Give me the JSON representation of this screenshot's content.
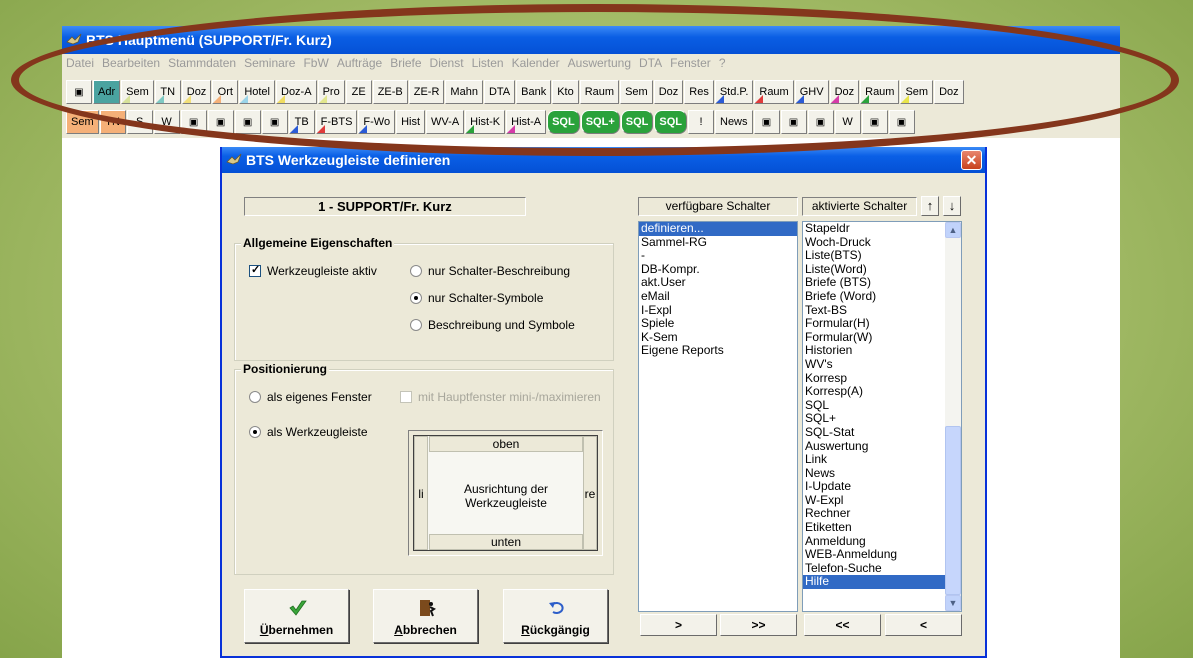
{
  "app": {
    "title": "BTS Hauptmenü (SUPPORT/Fr. Kurz)",
    "menu": [
      "Datei",
      "Bearbeiten",
      "Stammdaten",
      "Seminare",
      "FbW",
      "Aufträge",
      "Briefe",
      "Dienst",
      "Listen",
      "Kalender",
      "Auswertung",
      "DTA",
      "Fenster",
      "?"
    ]
  },
  "toolbar1": [
    {
      "label": "",
      "icon": "door-exit-icon"
    },
    {
      "label": "Adr",
      "color": "#4aa3a0",
      "style": "filled"
    },
    {
      "label": "Sem",
      "color": "#d7e29a"
    },
    {
      "label": "TN",
      "color": "#7ec9c3"
    },
    {
      "label": "Doz",
      "color": "#f2e07a"
    },
    {
      "label": "Ort",
      "color": "#f5b078"
    },
    {
      "label": "Hotel",
      "color": "#9ad4e8"
    },
    {
      "label": "Doz-A",
      "color": "#f0dc60"
    },
    {
      "label": "Pro",
      "color": "#e2e68c"
    },
    {
      "label": "ZE",
      "color": ""
    },
    {
      "label": "ZE-B",
      "color": ""
    },
    {
      "label": "ZE-R",
      "color": ""
    },
    {
      "label": "Mahn",
      "color": ""
    },
    {
      "label": "DTA",
      "icon": "dta-icon"
    },
    {
      "label": "Bank",
      "icon": "bank-icon"
    },
    {
      "label": "Kto",
      "icon": "account-icon"
    },
    {
      "label": "Raum",
      "color": ""
    },
    {
      "label": "Sem",
      "color": ""
    },
    {
      "label": "Doz",
      "color": ""
    },
    {
      "label": "Res",
      "color": ""
    },
    {
      "label": "Std.P.",
      "color": "#2b5bd6"
    },
    {
      "label": "Raum",
      "color": "#e03b3b"
    },
    {
      "label": "GHV",
      "color": "#2b5bd6"
    },
    {
      "label": "Doz",
      "color": "#d63ba8"
    },
    {
      "label": "Raum",
      "color": "#2aa23b"
    },
    {
      "label": "Sem",
      "color": "#e8e44a"
    },
    {
      "label": "Doz",
      "color": ""
    }
  ],
  "toolbar2": [
    {
      "label": "Sem",
      "color": "#f5b078",
      "style": "filled"
    },
    {
      "label": "TN",
      "color": "#f5b078",
      "style": "filled"
    },
    {
      "label": "S",
      "icon": "print-s-icon"
    },
    {
      "label": "W",
      "icon": "print-w-icon"
    },
    {
      "label": "",
      "icon": "form-bts-icon"
    },
    {
      "label": "",
      "icon": "form-w-icon"
    },
    {
      "label": "",
      "icon": "window-icon"
    },
    {
      "label": "",
      "icon": "window-w-icon"
    },
    {
      "label": "TB",
      "color": "#2b5bd6"
    },
    {
      "label": "F-BTS",
      "color": "#e03b3b"
    },
    {
      "label": "F-Wo",
      "color": "#2b5bd6"
    },
    {
      "label": "Hist",
      "color": ""
    },
    {
      "label": "WV-A",
      "color": ""
    },
    {
      "label": "Hist-K",
      "color": "#2aa23b"
    },
    {
      "label": "Hist-A",
      "color": "#d63ba8"
    },
    {
      "label": "SQL",
      "style": "sql"
    },
    {
      "label": "SQL+",
      "style": "sql"
    },
    {
      "label": "SQL",
      "style": "sql"
    },
    {
      "label": "SQL",
      "style": "sql"
    },
    {
      "label": "!",
      "icon": "alert-icon"
    },
    {
      "label": "News",
      "icon": "news-icon"
    },
    {
      "label": "",
      "icon": "update-icon"
    },
    {
      "label": "",
      "icon": "explorer-icon"
    },
    {
      "label": "",
      "icon": "calculator-icon"
    },
    {
      "label": "W",
      "icon": "label-w-icon"
    },
    {
      "label": "",
      "icon": "person-icon"
    },
    {
      "label": "",
      "icon": "person-help-icon"
    }
  ],
  "dialog": {
    "title": "BTS Werkzeugleiste definieren",
    "close_label": "✕",
    "profile": "1 - SUPPORT/Fr. Kurz",
    "group_general": "Allgemeine Eigenschaften",
    "toolbar_active_label": "Werkzeugleiste aktiv",
    "opt_desc_only": "nur Schalter-Beschreibung",
    "opt_symbols_only": "nur Schalter-Symbole",
    "opt_both": "Beschreibung und Symbole",
    "group_position": "Positionierung",
    "opt_own_window": "als eigenes Fenster",
    "opt_mainwin_minmax": "mit Hauptfenster mini-/maximieren",
    "opt_as_toolbar": "als Werkzeugleiste",
    "orient_top": "oben",
    "orient_bottom": "unten",
    "orient_left": "li",
    "orient_right": "re",
    "orient_center": "Ausrichtung der Werkzeugleiste",
    "btn_apply_u": "Ü",
    "btn_apply_rest": "bernehmen",
    "btn_cancel_u": "A",
    "btn_cancel_rest": "bbrechen",
    "btn_undo_u": "R",
    "btn_undo_rest": "ückgängig",
    "hdr_available": "verfügbare Schalter",
    "hdr_active": "aktivierte Schalter",
    "up_arrow": "↑",
    "down_arrow": "↓",
    "move_right_one": ">",
    "move_right_all": ">>",
    "move_left_all": "<<",
    "move_left_one": "<"
  },
  "available_list": [
    "definieren...",
    "Sammel-RG",
    "-",
    "DB-Kompr.",
    "akt.User",
    "eMail",
    "I-Expl",
    "Spiele",
    "K-Sem",
    "Eigene Reports"
  ],
  "available_selected": 0,
  "active_list": [
    "Stapeldr",
    "Woch-Druck",
    "Liste(BTS)",
    "Liste(Word)",
    "Briefe (BTS)",
    "Briefe (Word)",
    "Text-BS",
    "Formular(H)",
    "Formular(W)",
    "Historien",
    "WV's",
    "Korresp",
    "Korresp(A)",
    "SQL",
    "SQL+",
    "SQL-Stat",
    "Auswertung",
    "Link",
    "News",
    "I-Update",
    "W-Expl",
    "Rechner",
    "Etiketten",
    "Anmeldung",
    "WEB-Anmeldung",
    "Telefon-Suche",
    "Hilfe"
  ],
  "active_selected": 26,
  "active_scroll_fraction": 0.56,
  "colors": {
    "accent": "#0a5ee4",
    "selection": "#316ac5",
    "annotation_ellipse": "#84361c"
  }
}
